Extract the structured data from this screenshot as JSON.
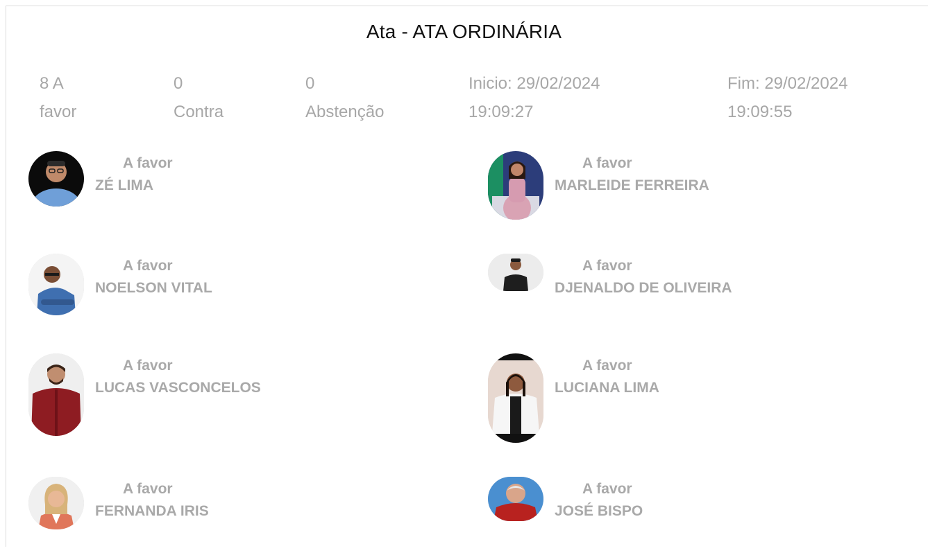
{
  "title": "Ata - ATA ORDINÁRIA",
  "stats": {
    "favor": {
      "value": "8 A",
      "label": "favor"
    },
    "contra": {
      "value": "0",
      "label": "Contra"
    },
    "abstencao": {
      "value": "0",
      "label": "Abstenção"
    },
    "inicio": {
      "label": "Inicio: 29/02/2024",
      "time": "19:09:27"
    },
    "fim": {
      "label": "Fim: 29/02/2024",
      "time": "19:09:55"
    }
  },
  "votes": [
    {
      "vote": "A favor",
      "name": "ZÉ LIMA"
    },
    {
      "vote": "A favor",
      "name": "MARLEIDE FERREIRA"
    },
    {
      "vote": "A favor",
      "name": "NOELSON VITAL"
    },
    {
      "vote": "A favor",
      "name": "DJENALDO DE OLIVEIRA"
    },
    {
      "vote": "A favor",
      "name": "LUCAS VASCONCELOS"
    },
    {
      "vote": "A favor",
      "name": "LUCIANA LIMA"
    },
    {
      "vote": "A favor",
      "name": "FERNANDA IRIS"
    },
    {
      "vote": "A favor",
      "name": "JOSÉ BISPO"
    }
  ]
}
